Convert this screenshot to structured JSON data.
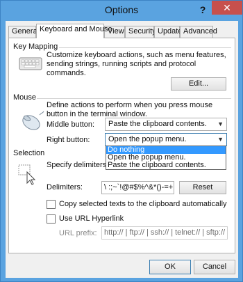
{
  "window": {
    "title": "Options",
    "help_label": "?",
    "close_label": "✕"
  },
  "tabs": [
    {
      "label": "General"
    },
    {
      "label": "Keyboard and Mouse"
    },
    {
      "label": "View"
    },
    {
      "label": "Security"
    },
    {
      "label": "Update"
    },
    {
      "label": "Advanced"
    }
  ],
  "key_mapping": {
    "title": "Key Mapping",
    "description": "Customize keyboard actions, such as menu features, sending strings, running scripts and protocol commands.",
    "edit_label": "Edit..."
  },
  "mouse": {
    "title": "Mouse",
    "description": "Define actions to perform when you press mouse button in the terminal window.",
    "middle_label": "Middle button:",
    "middle_value": "Paste the clipboard contents.",
    "right_label": "Right button:",
    "right_value": "Open the popup menu.",
    "dropdown_options": [
      "Do nothing",
      "Open the popup menu.",
      "Paste the clipboard contents."
    ]
  },
  "selection": {
    "title": "Selection",
    "description": "Specify delimiters to use when you double click.",
    "delimiters_label": "Delimiters:",
    "delimiters_value": "\\ :;~`!@#$%^&*()-=+|[]{}'\",.<>/?",
    "reset_label": "Reset",
    "copy_label": "Copy selected texts to the clipboard automatically",
    "use_url_label": "Use URL Hyperlink",
    "url_prefix_label": "URL prefix:",
    "url_prefix_value": "http:// | ftp:// | ssh:// | telnet:// | sftp:// | rlogin://"
  },
  "footer": {
    "ok_label": "OK",
    "cancel_label": "Cancel"
  },
  "colors": {
    "titlebar": "#5aa3e0",
    "close": "#c7504c",
    "selection_highlight": "#3399ff"
  }
}
